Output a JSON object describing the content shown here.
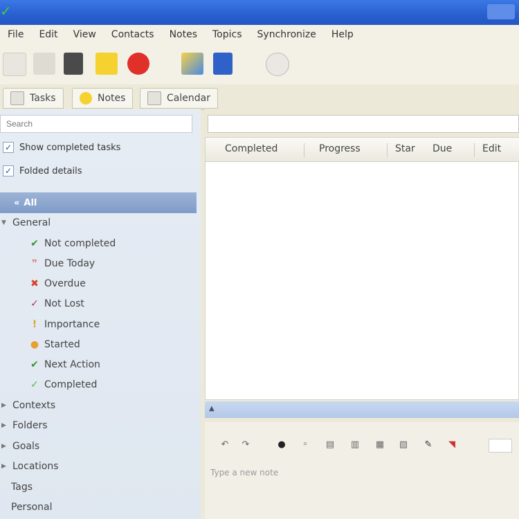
{
  "menu": [
    "File",
    "Edit",
    "View",
    "Contacts",
    "Notes",
    "Topics",
    "Synchronize",
    "Help"
  ],
  "toolbar": {
    "icons": [
      "new-note-icon",
      "list-icon",
      "notebook-icon",
      "folder-icon",
      "stop-icon",
      "contact-card-icon",
      "pause-icon",
      "clock-icon"
    ]
  },
  "view_tabs": [
    {
      "label": "Tasks",
      "icon": "tasks-icon"
    },
    {
      "label": "Notes",
      "icon": "star-icon"
    },
    {
      "label": "Calendar",
      "icon": "calendar-icon"
    }
  ],
  "sidebar": {
    "search_placeholder": "Search",
    "options": [
      {
        "label": "Show completed tasks",
        "checked": true
      },
      {
        "label": "Folded details",
        "checked": true
      }
    ],
    "all_label": "All",
    "tree_general": "General",
    "tree_items": [
      {
        "label": "Not completed",
        "icon": "✔",
        "color": "#2e9b2e"
      },
      {
        "label": "Due Today",
        "icon": "❞",
        "color": "#d88a8a"
      },
      {
        "label": "Overdue",
        "icon": "✖",
        "color": "#d9412c"
      },
      {
        "label": "Not Lost",
        "icon": "✓",
        "color": "#c0306a"
      },
      {
        "label": "Importance",
        "icon": "!",
        "color": "#e4a11b"
      },
      {
        "label": "Started",
        "icon": "●",
        "color": "#e8a030"
      },
      {
        "label": "Next Action",
        "icon": "✔",
        "color": "#2e9b2e"
      },
      {
        "label": "Completed",
        "icon": "✓",
        "color": "#58b84a"
      }
    ],
    "tree_sections": [
      "Contexts",
      "Folders",
      "Goals",
      "Locations",
      "Tags",
      "Personal"
    ]
  },
  "grid": {
    "columns": [
      "Completed",
      "Progress",
      "Star",
      "Due",
      "Edit"
    ]
  },
  "notes": {
    "placeholder": "Type a new note",
    "tools": [
      "↶",
      "↷",
      "●",
      "◦",
      "▤",
      "▥",
      "▦",
      "▧",
      "✎",
      "◥"
    ]
  }
}
